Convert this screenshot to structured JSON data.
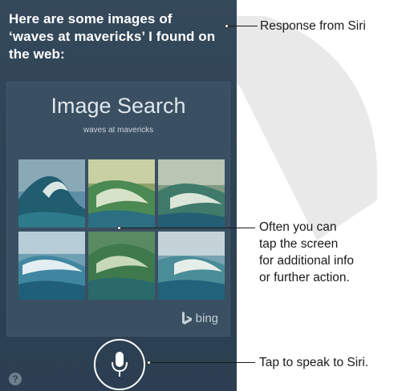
{
  "siri": {
    "response": "Here are some images of ‘waves at mavericks’ I found on the web:"
  },
  "image_search": {
    "title": "Image Search",
    "query": "waves at mavericks",
    "provider": "bing"
  },
  "controls": {
    "help_label": "?"
  },
  "callouts": {
    "response": "Response from Siri",
    "tap_line1": "Often you can",
    "tap_line2": "tap the screen",
    "tap_line3": "for additional info",
    "tap_line4": "or further action.",
    "speak": "Tap to speak to Siri."
  },
  "colors": {
    "screen_bg": "#2f4356",
    "card_bg": "#3a5062",
    "text": "#ffffff"
  }
}
